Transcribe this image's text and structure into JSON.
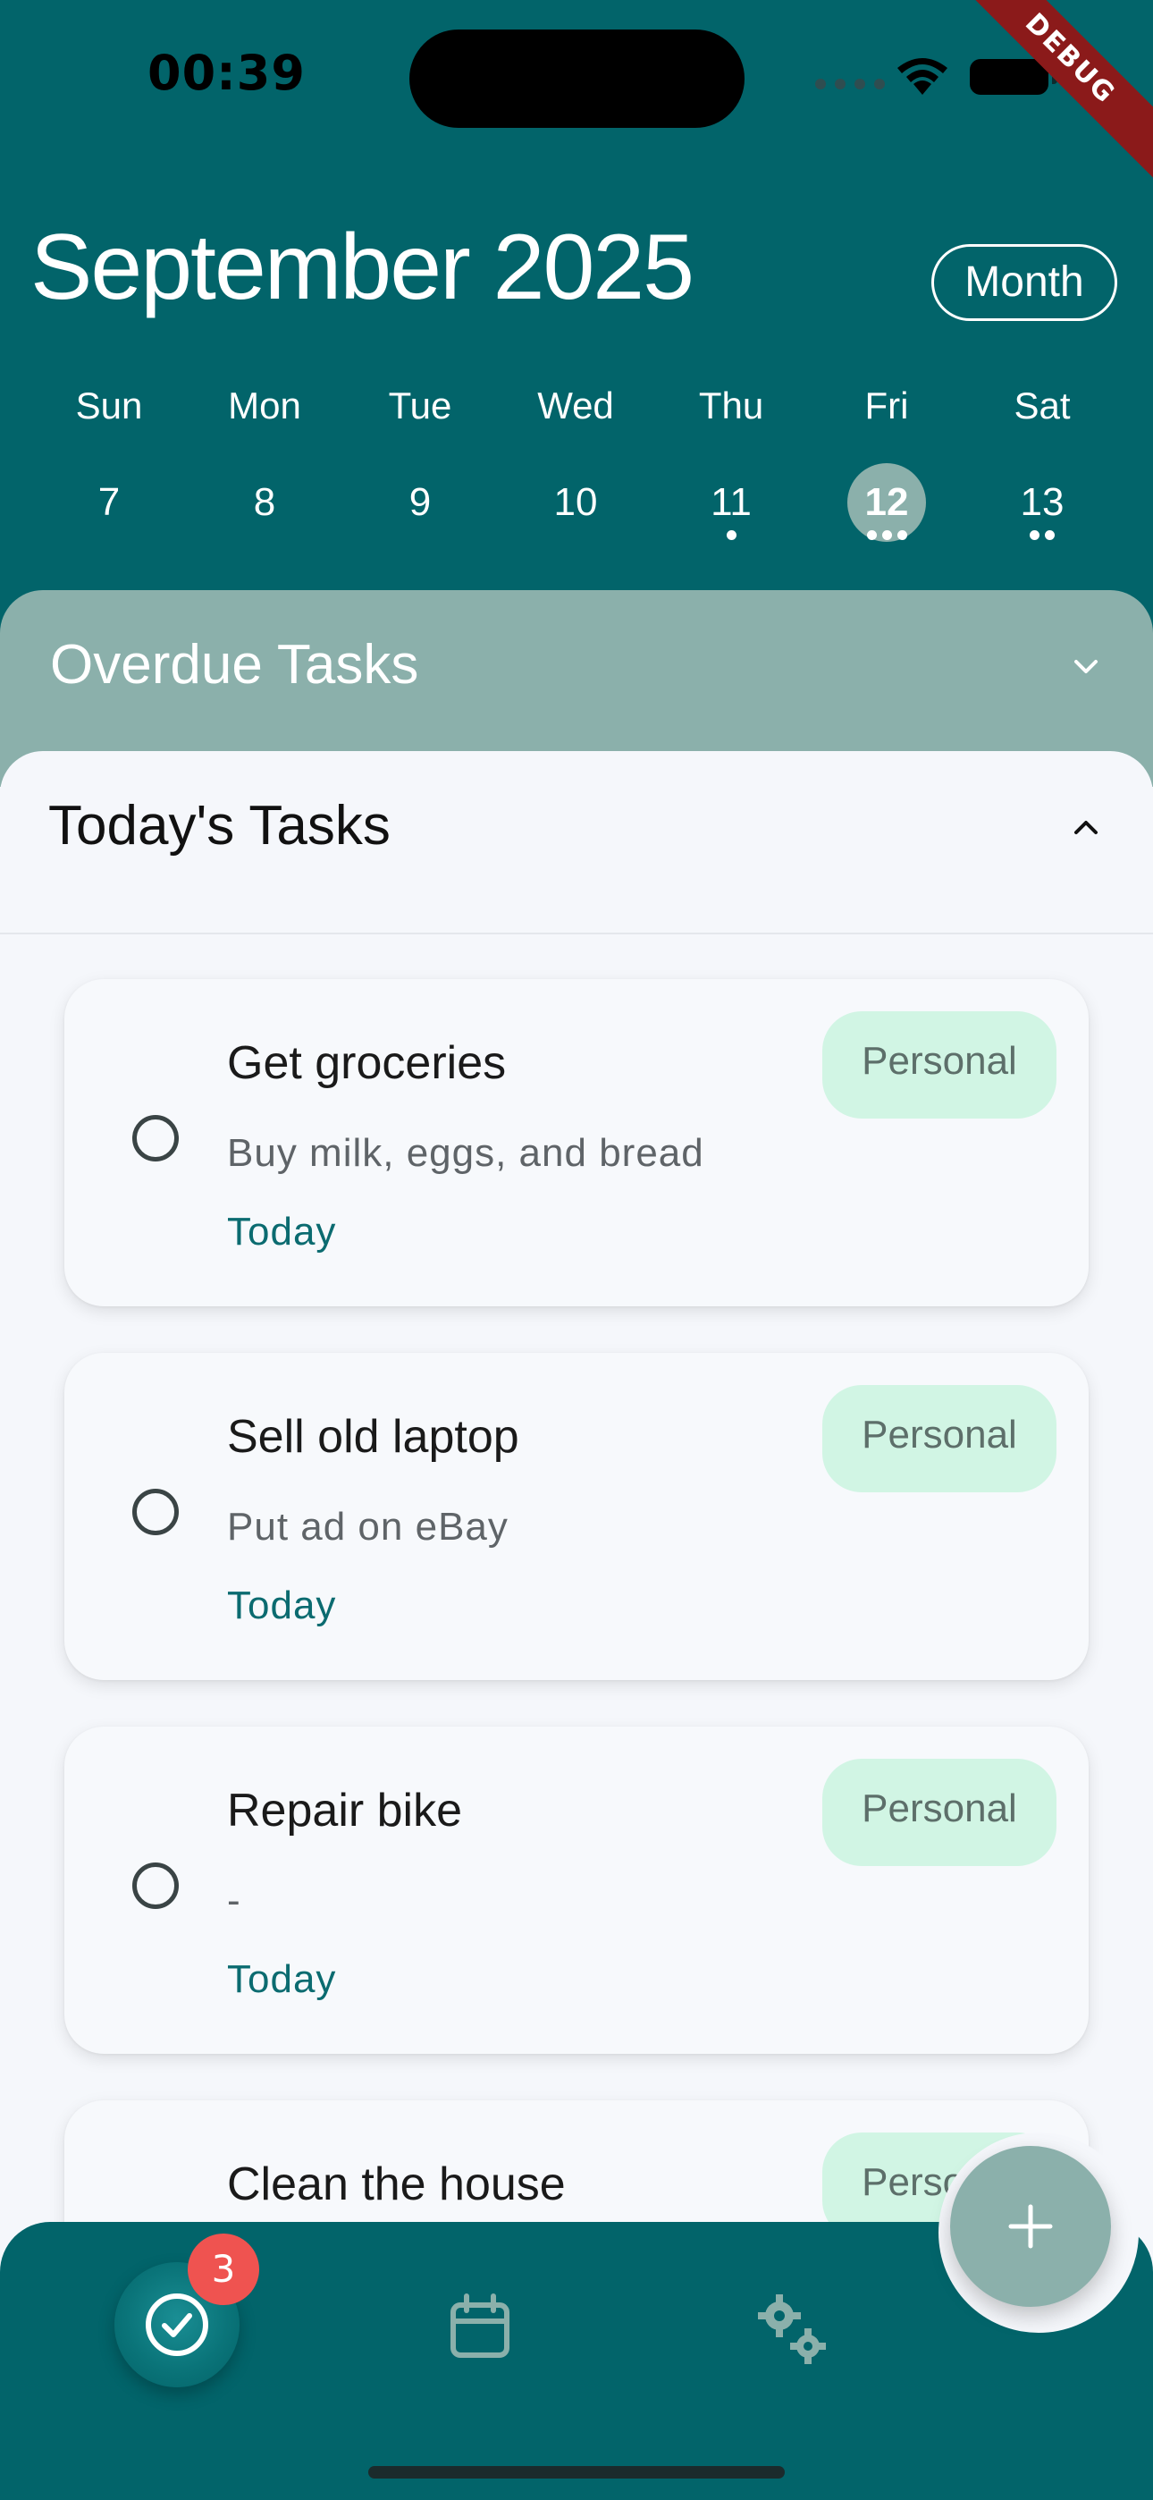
{
  "status_bar": {
    "time": "00:39",
    "debug_label": "DEBUG"
  },
  "header": {
    "month_title": "September 2025",
    "view_toggle": "Month"
  },
  "week": [
    {
      "name": "Sun",
      "num": "7",
      "dots": 0,
      "selected": false
    },
    {
      "name": "Mon",
      "num": "8",
      "dots": 0,
      "selected": false
    },
    {
      "name": "Tue",
      "num": "9",
      "dots": 0,
      "selected": false
    },
    {
      "name": "Wed",
      "num": "10",
      "dots": 0,
      "selected": false
    },
    {
      "name": "Thu",
      "num": "11",
      "dots": 1,
      "selected": false
    },
    {
      "name": "Fri",
      "num": "12",
      "dots": 3,
      "selected": true
    },
    {
      "name": "Sat",
      "num": "13",
      "dots": 2,
      "selected": false
    }
  ],
  "sections": {
    "overdue": {
      "title": "Overdue Tasks"
    },
    "today": {
      "title": "Today's Tasks"
    }
  },
  "tasks": [
    {
      "title": "Get groceries",
      "description": "Buy milk, eggs, and bread",
      "date": "Today",
      "tag": "Personal"
    },
    {
      "title": "Sell old laptop",
      "description": "Put ad on eBay",
      "date": "Today",
      "tag": "Personal"
    },
    {
      "title": "Repair bike",
      "description": "-",
      "date": "Today",
      "tag": "Personal"
    },
    {
      "title": "Clean the house",
      "description": "",
      "date": "",
      "tag": "Personal"
    }
  ],
  "nav": {
    "badge_count": "3",
    "items": [
      {
        "icon": "check-circle-icon",
        "active": true
      },
      {
        "icon": "calendar-icon",
        "active": false
      },
      {
        "icon": "gears-icon",
        "active": false
      }
    ],
    "fab_icon": "plus-icon"
  },
  "colors": {
    "primary": "#02646A",
    "muted_teal": "#8BB0AB",
    "tag_bg": "#D1F5E4",
    "badge": "#EF5350",
    "date_text": "#0B6B70"
  }
}
